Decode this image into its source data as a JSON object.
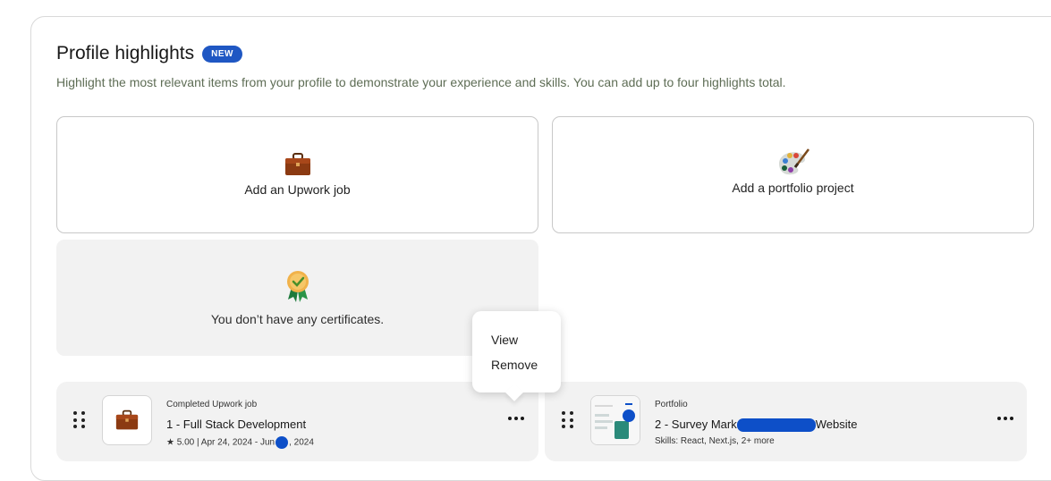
{
  "section": {
    "title": "Profile highlights",
    "badge": "NEW",
    "subtitle": "Highlight the most relevant items from your profile to demonstrate your experience and skills. You can add up to four highlights total."
  },
  "add_cards": {
    "job": {
      "label": "Add an Upwork job",
      "icon": "briefcase-icon"
    },
    "portfolio": {
      "label": "Add a portfolio project",
      "icon": "palette-icon"
    },
    "certificate": {
      "label": "You don’t have any certificates.",
      "icon": "award-ribbon-icon"
    }
  },
  "highlights": [
    {
      "type": "Completed Upwork job",
      "title": "1 - Full Stack Development",
      "meta_prefix": "★ 5.00 | Apr 24, 2024 - Jun",
      "meta_suffix": ", 2024",
      "icon": "briefcase-icon"
    },
    {
      "type": "Portfolio",
      "title_prefix": "2 - Survey Mark",
      "title_suffix": "Website",
      "meta": "Skills: React, Next.js, 2+ more",
      "icon": "portfolio-thumbnail"
    }
  ],
  "menu": {
    "items": [
      "View",
      "Remove"
    ]
  },
  "colors": {
    "accent": "#1f57c3",
    "highlight_bg": "#f2f2f2",
    "redaction": "#0d4fc8"
  }
}
